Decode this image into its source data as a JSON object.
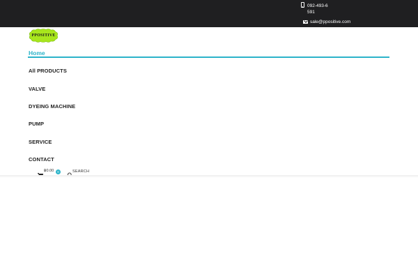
{
  "topbar": {
    "phone": "092-493-6591",
    "email": "sale@ppositive.com",
    "phone_icon": "mobile-phone-icon",
    "email_icon": "envelope-icon",
    "background": "#1f1f21"
  },
  "logo": {
    "text": "PPOSITIVE",
    "color": "#a8e61d"
  },
  "nav": {
    "home_label": "Home",
    "items": [
      "All PRODUCTS",
      "VALVE",
      "DYEING MACHINE",
      "PUMP",
      "SERVICE",
      "CONTACT"
    ],
    "accent": "#2bb3c9"
  },
  "cart": {
    "icon": "shopping-cart-icon",
    "total": "฿0.00",
    "count": "0"
  },
  "search": {
    "icon": "search-icon",
    "label": "SEARCH"
  }
}
